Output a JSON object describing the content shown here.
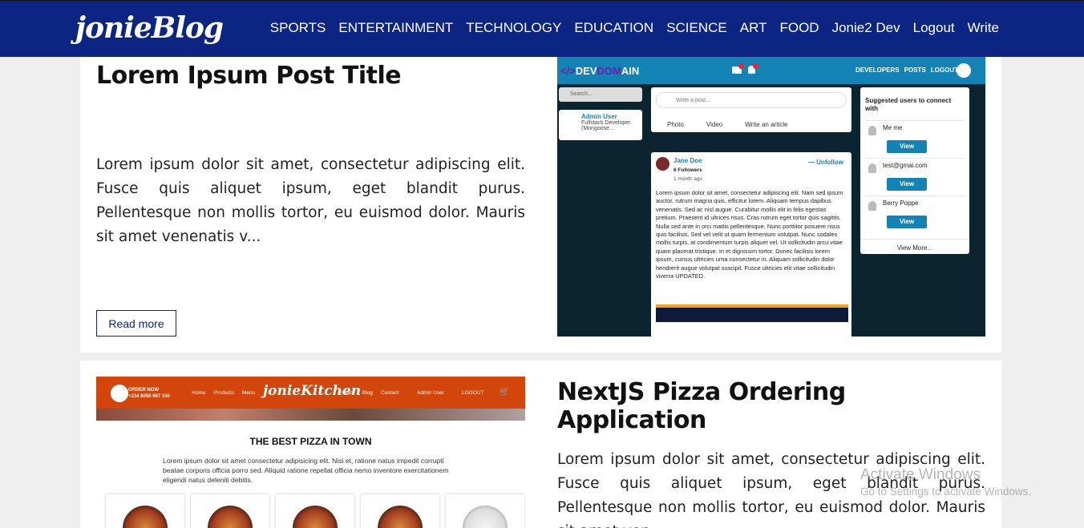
{
  "navbar": {
    "logo": "jonieBlog",
    "links": [
      "SPORTS",
      "ENTERTAINMENT",
      "TECHNOLOGY",
      "EDUCATION",
      "SCIENCE",
      "ART",
      "FOOD"
    ],
    "user": "Jonie2 Dev",
    "logout": "Logout",
    "write": "Write"
  },
  "posts": [
    {
      "title": "Lorem Ipsum Post Title",
      "excerpt": "Lorem ipsum dolor sit amet, consectetur adipiscing elit. Fusce quis aliquet ipsum, eget blandit purus. Pellentesque non mollis tortor, eu euismod dolor. Mauris sit amet venenatis v...",
      "read_more": "Read more",
      "image": {
        "logo_left": "</>",
        "logo_dev": "DEV",
        "logo_dom": "DOM",
        "logo_ain": "AIN",
        "badge_msg": "5",
        "badge_notif": "3",
        "nav": [
          "DEVELOPERS",
          "POSTS",
          "LOGOUT"
        ],
        "search_placeholder": "Search...",
        "profile_name": "Admin User",
        "profile_bio": "Fullstack Developer. (Mongoose...",
        "compose_placeholder": "Write a post...",
        "compose_actions": [
          "Photo",
          "Video",
          "Write an article"
        ],
        "post_author": "Jane Doe",
        "post_followers": "6 Followers",
        "post_time": "1 month ago",
        "post_unfollow": "Unfollow",
        "post_body": "Lorem ipsum dolor sit amet, consectetur adipiscing elit. Nam sed ipsum auctor, rutrum magna quis, efficitur lorem. Aliquam tempus dapibus venenatis. Sed ac nisl augue. Curabitur mollis elit in felis egestas pretium. Praesent id ultrices risus. Cras rutrum eget tortor quis sagittis. Nulla sed ante in orci mattis pellentesque. Nunc porttitor posuere risus quis facilisis. Sed vel velit ut quam fermentum volutpat. Nunc sodales mollis turpis, at condimentum turpis aliquet vel. Ut sollicitudin arcu vitae quam placerat tristique. In et dignissim tortor. Donec facilisis lorem ipsum, cursus ultricies urna consectetur in. Aliquam sollicitudin dolor hendrerit augue volutpat suscipit. Fusce ultricies elit vitae sollicitudin viverra UPDATED.",
        "suggest_title": "Suggested users to connect with",
        "suggest_users": [
          "Me me",
          "test@gmai.com",
          "Berry Poppe"
        ],
        "view_label": "View",
        "view_more": "View More..."
      }
    },
    {
      "title": "NextJS Pizza Ordering Application",
      "excerpt": "Lorem ipsum dolor sit amet, consectetur adipiscing elit. Fusce quis aliquet ipsum, eget blandit purus. Pellentesque non mollis tortor, eu euismod dolor. Mauris sit amet ven...",
      "image": {
        "order_now": "ORDER NOW",
        "phone": "+234 8050 667 156",
        "links_left": [
          "Home",
          "Products",
          "Menu"
        ],
        "brand": "jonieKitchen",
        "links_right": [
          "Events",
          "Blog",
          "Contact"
        ],
        "admin": "Admin User",
        "logout": "LOGOUT",
        "cart_count": "1",
        "heading": "THE BEST PIZZA IN TOWN",
        "desc": "Lorem ipsum dolor sit amet consectetur adipisicing elit. Nisi et, ratione natus impedit corrupti beatae corporis officia porro sed. Aliquid ratione repellat officia nemo inventore exercitationem eligendi natus deleniti debitis."
      }
    }
  ],
  "watermark": {
    "line1": "Activate Windows",
    "line2": "Go to Settings to activate Windows."
  },
  "colors": {
    "navbar": "#0c2582",
    "devdomain_nav": "#1382b5",
    "kitchen_nav": "#d2460c"
  }
}
